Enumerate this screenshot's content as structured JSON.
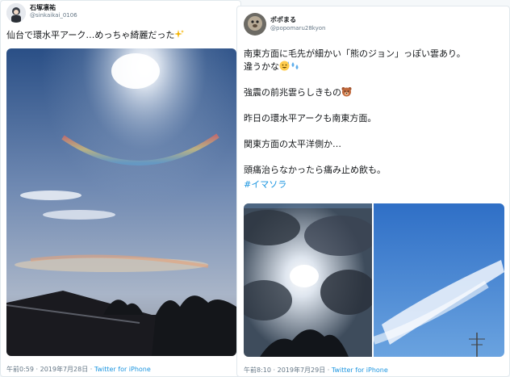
{
  "tweet_left": {
    "display_name": "石塚凛祐",
    "handle": "@sinkaikai_0106",
    "text": "仙台で環水平アーク…めっちゃ綺麗だった",
    "meta": {
      "time": "午前0:59",
      "date": "2019年7月28日",
      "source": "Twitter for iPhone"
    }
  },
  "tweet_right": {
    "display_name": "ポポまる",
    "handle": "@popomaru28kyon",
    "lines": {
      "l1": "南東方面に毛先が細かい「熊のジョン」っぽい雲あり。",
      "l2": "違うかな",
      "l3": "強震の前兆雲らしきもの",
      "l4": "昨日の環水平アークも南東方面。",
      "l5": "関東方面の太平洋側か…",
      "l6": "頭痛治らなかったら痛み止め飲も。"
    },
    "hashtag": "#イマソラ",
    "meta": {
      "time": "午前8:10",
      "date": "2019年7月29日",
      "source": "Twitter for iPhone"
    }
  },
  "icons": {
    "sparkles": "sparkles-icon",
    "grin_sweat": "grinning-sweat-face-icon",
    "sweat_droplets": "sweat-droplets-icon",
    "bear": "bear-face-icon"
  },
  "colors": {
    "text": "#14171a",
    "secondary": "#657786",
    "link": "#1b95e0",
    "border": "#e1e8ed"
  }
}
